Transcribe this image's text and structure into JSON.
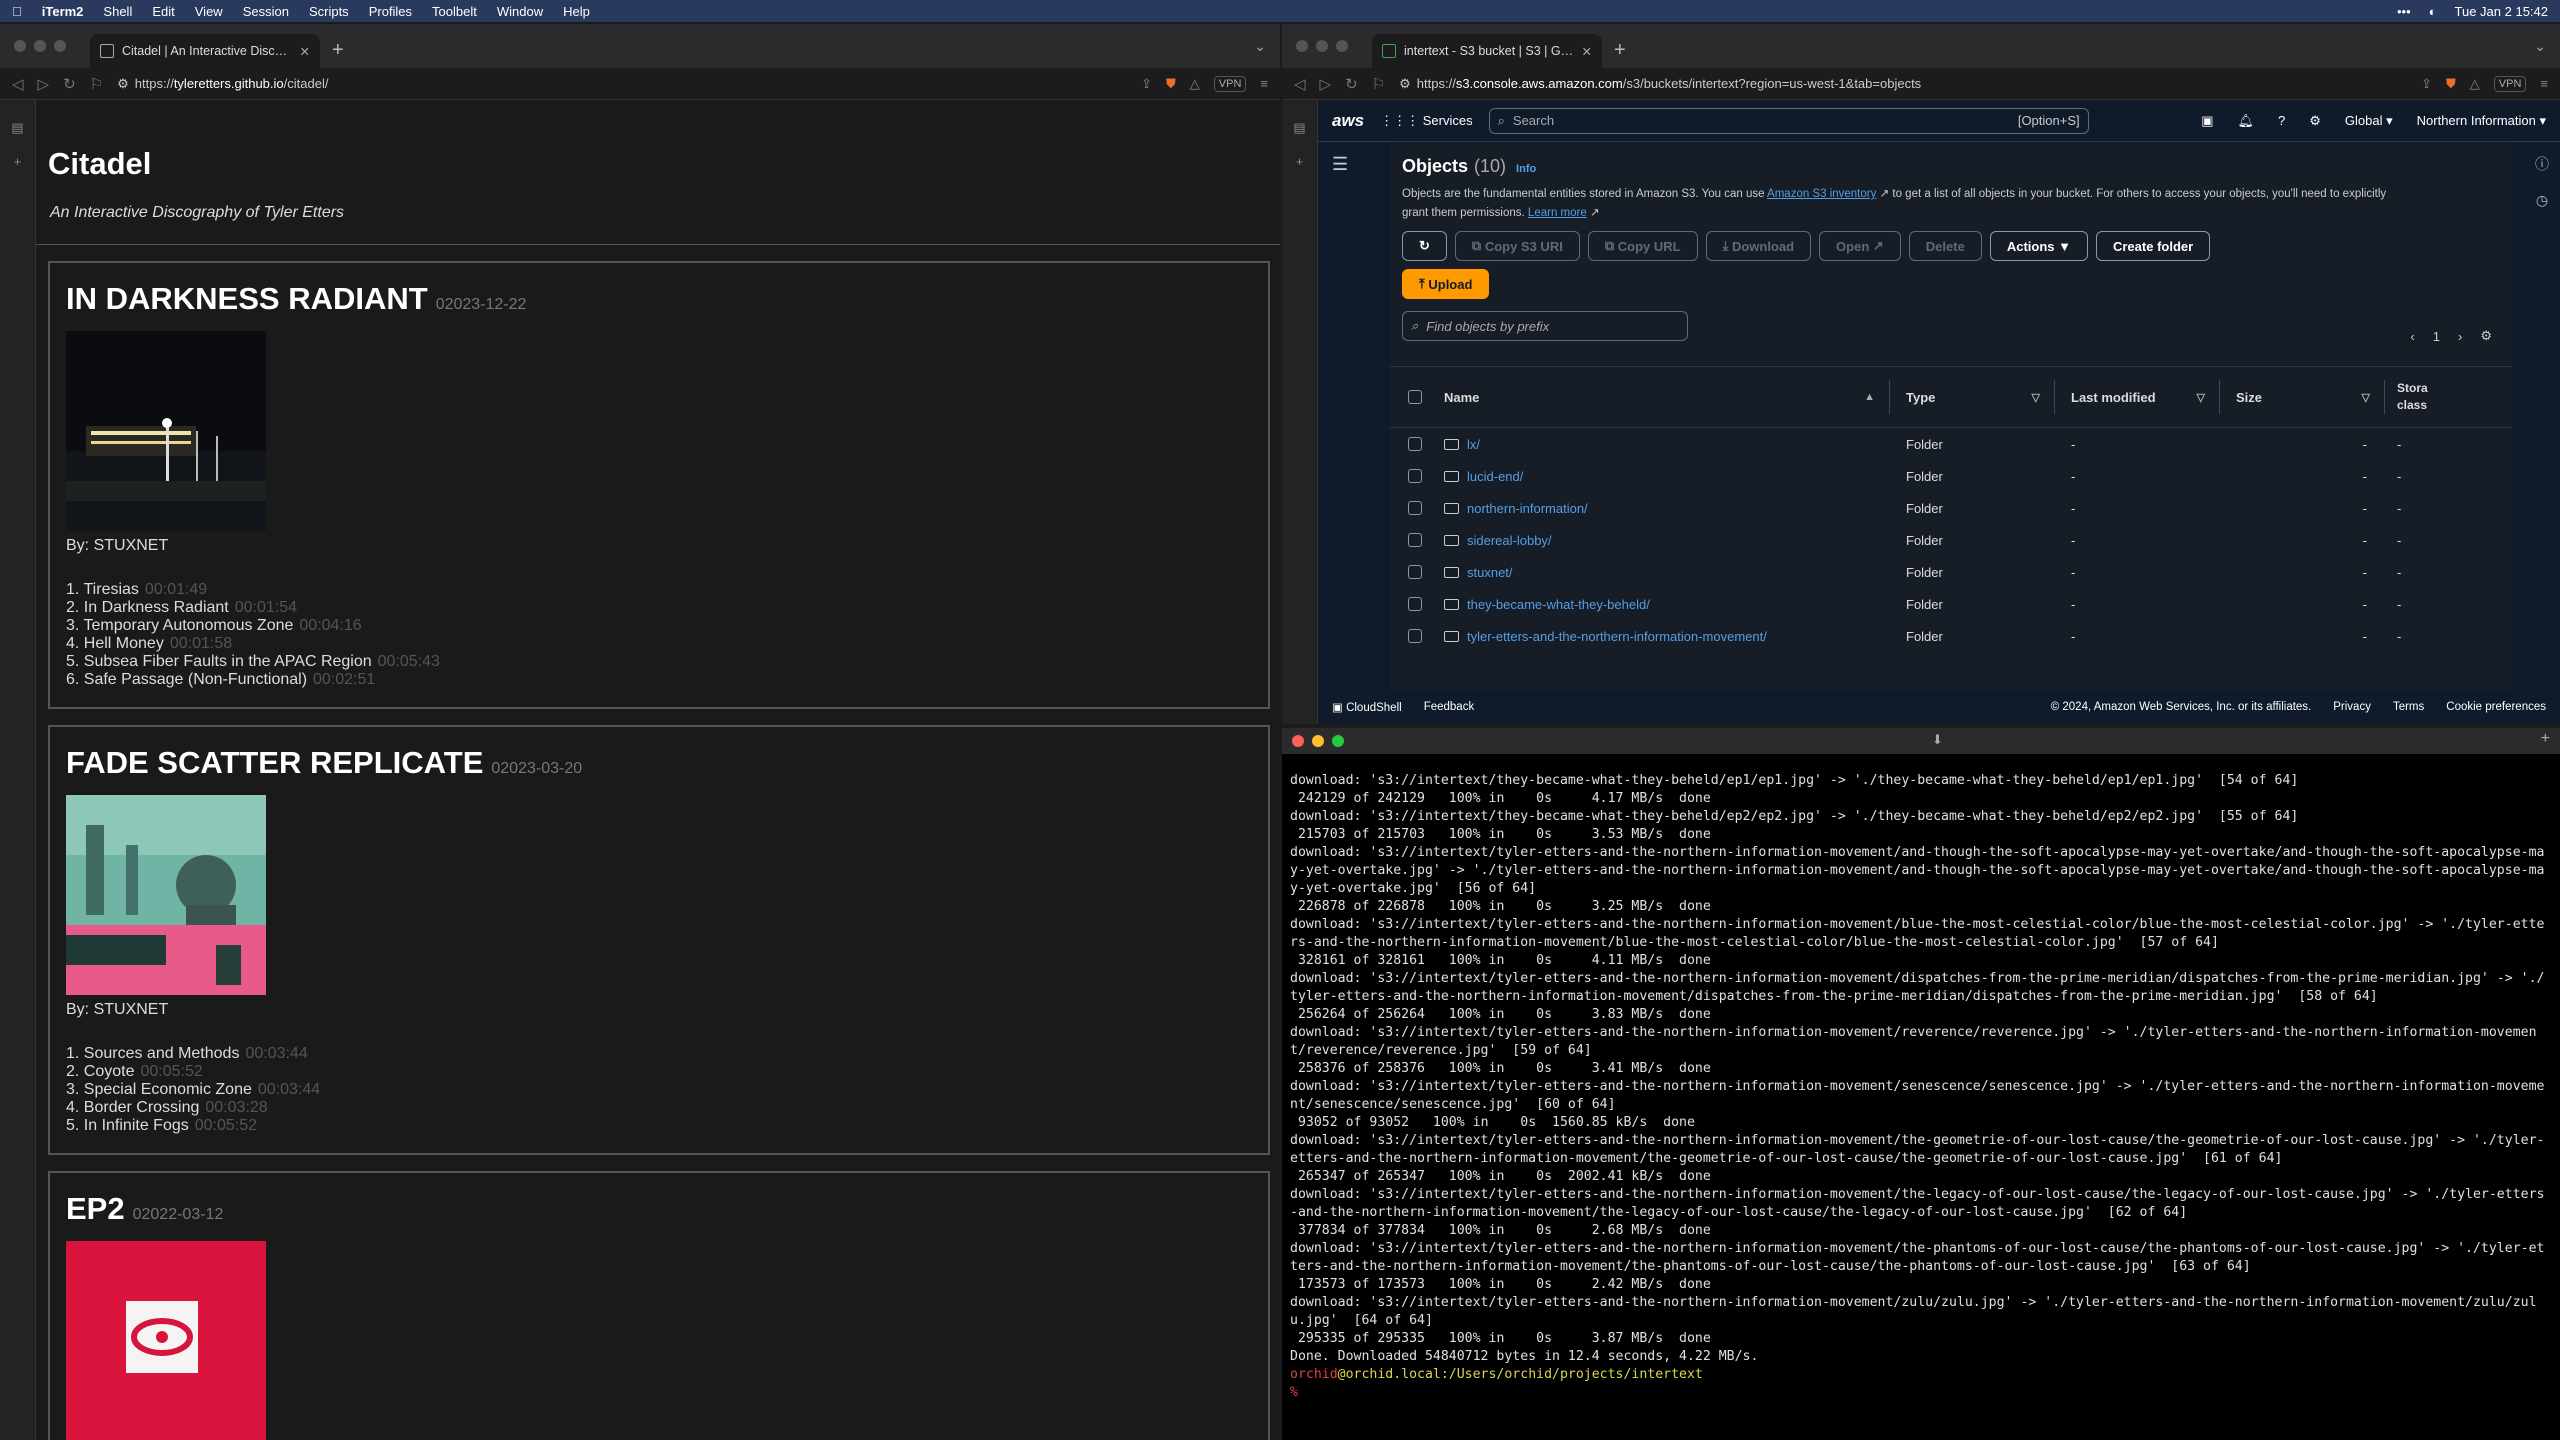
{
  "menubar": {
    "app": "iTerm2",
    "items": [
      "Shell",
      "Edit",
      "View",
      "Session",
      "Scripts",
      "Profiles",
      "Toolbelt",
      "Window",
      "Help"
    ],
    "clock": "Tue Jan 2  15:42"
  },
  "left_browser": {
    "tab_title": "Citadel | An Interactive Discogr...",
    "url_prefix": "https://",
    "url_host": "tyleretters.github.io",
    "url_path": "/citadel/",
    "vpn": "VPN",
    "page": {
      "title": "Citadel",
      "subtitle": "An Interactive Discography of Tyler Etters",
      "albums": [
        {
          "name": "IN DARKNESS RADIANT",
          "date": "02023-12-22",
          "by": "By: STUXNET",
          "tracks": [
            {
              "t": "1. Tiresias",
              "d": "00:01:49"
            },
            {
              "t": "2. In Darkness Radiant",
              "d": "00:01:54"
            },
            {
              "t": "3. Temporary Autonomous Zone",
              "d": "00:04:16"
            },
            {
              "t": "4. Hell Money",
              "d": "00:01:58"
            },
            {
              "t": "5. Subsea Fiber Faults in the APAC Region",
              "d": "00:05:43"
            },
            {
              "t": "6. Safe Passage (Non-Functional)",
              "d": "00:02:51"
            }
          ]
        },
        {
          "name": "FADE SCATTER REPLICATE",
          "date": "02023-03-20",
          "by": "By: STUXNET",
          "tracks": [
            {
              "t": "1. Sources and Methods",
              "d": "00:03:44"
            },
            {
              "t": "2. Coyote",
              "d": "00:05:52"
            },
            {
              "t": "3. Special Economic Zone",
              "d": "00:03:44"
            },
            {
              "t": "4. Border Crossing",
              "d": "00:03:28"
            },
            {
              "t": "5. In Infinite Fogs",
              "d": "00:05:52"
            }
          ]
        },
        {
          "name": "EP2",
          "date": "02022-03-12",
          "by": "",
          "tracks": []
        }
      ]
    }
  },
  "right_browser": {
    "tab_title": "intertext - S3 bucket | S3 | Glo...",
    "url_prefix": "https://",
    "url_host": "s3.console.aws.amazon.com",
    "url_path": "/s3/buckets/intertext?region=us-west-1&tab=objects",
    "vpn": "VPN",
    "aws": {
      "logo": "aws",
      "services": "Services",
      "search_placeholder": "Search",
      "search_kbd": "[Option+S]",
      "region": "Global ▾",
      "account": "Northern Information ▾",
      "objects_title": "Objects",
      "objects_count": "(10)",
      "info": "Info",
      "desc_1": "Objects are the fundamental entities stored in Amazon S3. You can use ",
      "desc_link": "Amazon S3 inventory",
      "desc_2": " to get a list of all objects in your bucket. For others to access your objects, you'll need to explicitly grant them permissions. ",
      "desc_learn": "Learn more",
      "buttons": {
        "copy_uri": "Copy S3 URI",
        "copy_url": "Copy URL",
        "download": "Download",
        "open": "Open",
        "delete": "Delete",
        "actions": "Actions ▼",
        "create_folder": "Create folder",
        "upload": "Upload"
      },
      "find_placeholder": "Find objects by prefix",
      "page_num": "1",
      "columns": {
        "name": "Name",
        "type": "Type",
        "modified": "Last modified",
        "size": "Size",
        "storage": "Stora class"
      },
      "rows": [
        {
          "name": "lx/",
          "type": "Folder",
          "modified": "-",
          "size": "-",
          "storage": "-"
        },
        {
          "name": "lucid-end/",
          "type": "Folder",
          "modified": "-",
          "size": "-",
          "storage": "-"
        },
        {
          "name": "northern-information/",
          "type": "Folder",
          "modified": "-",
          "size": "-",
          "storage": "-"
        },
        {
          "name": "sidereal-lobby/",
          "type": "Folder",
          "modified": "-",
          "size": "-",
          "storage": "-"
        },
        {
          "name": "stuxnet/",
          "type": "Folder",
          "modified": "-",
          "size": "-",
          "storage": "-"
        },
        {
          "name": "they-became-what-they-beheld/",
          "type": "Folder",
          "modified": "-",
          "size": "-",
          "storage": "-"
        },
        {
          "name": "tyler-etters-and-the-northern-information-movement/",
          "type": "Folder",
          "modified": "-",
          "size": "-",
          "storage": "-"
        }
      ],
      "footer": {
        "cloudshell": "CloudShell",
        "feedback": "Feedback",
        "copyright": "© 2024, Amazon Web Services, Inc. or its affiliates.",
        "privacy": "Privacy",
        "terms": "Terms",
        "cookie": "Cookie preferences"
      }
    }
  },
  "terminal": {
    "output": "download: 's3://intertext/they-became-what-they-beheld/ep1/ep1.jpg' -> './they-became-what-they-beheld/ep1/ep1.jpg'  [54 of 64]\n 242129 of 242129   100% in    0s     4.17 MB/s  done\ndownload: 's3://intertext/they-became-what-they-beheld/ep2/ep2.jpg' -> './they-became-what-they-beheld/ep2/ep2.jpg'  [55 of 64]\n 215703 of 215703   100% in    0s     3.53 MB/s  done\ndownload: 's3://intertext/tyler-etters-and-the-northern-information-movement/and-though-the-soft-apocalypse-may-yet-overtake/and-though-the-soft-apocalypse-may-yet-overtake.jpg' -> './tyler-etters-and-the-northern-information-movement/and-though-the-soft-apocalypse-may-yet-overtake/and-though-the-soft-apocalypse-may-yet-overtake.jpg'  [56 of 64]\n 226878 of 226878   100% in    0s     3.25 MB/s  done\ndownload: 's3://intertext/tyler-etters-and-the-northern-information-movement/blue-the-most-celestial-color/blue-the-most-celestial-color.jpg' -> './tyler-etters-and-the-northern-information-movement/blue-the-most-celestial-color/blue-the-most-celestial-color.jpg'  [57 of 64]\n 328161 of 328161   100% in    0s     4.11 MB/s  done\ndownload: 's3://intertext/tyler-etters-and-the-northern-information-movement/dispatches-from-the-prime-meridian/dispatches-from-the-prime-meridian.jpg' -> './tyler-etters-and-the-northern-information-movement/dispatches-from-the-prime-meridian/dispatches-from-the-prime-meridian.jpg'  [58 of 64]\n 256264 of 256264   100% in    0s     3.83 MB/s  done\ndownload: 's3://intertext/tyler-etters-and-the-northern-information-movement/reverence/reverence.jpg' -> './tyler-etters-and-the-northern-information-movement/reverence/reverence.jpg'  [59 of 64]\n 258376 of 258376   100% in    0s     3.41 MB/s  done\ndownload: 's3://intertext/tyler-etters-and-the-northern-information-movement/senescence/senescence.jpg' -> './tyler-etters-and-the-northern-information-movement/senescence/senescence.jpg'  [60 of 64]\n 93052 of 93052   100% in    0s  1560.85 kB/s  done\ndownload: 's3://intertext/tyler-etters-and-the-northern-information-movement/the-geometrie-of-our-lost-cause/the-geometrie-of-our-lost-cause.jpg' -> './tyler-etters-and-the-northern-information-movement/the-geometrie-of-our-lost-cause/the-geometrie-of-our-lost-cause.jpg'  [61 of 64]\n 265347 of 265347   100% in    0s  2002.41 kB/s  done\ndownload: 's3://intertext/tyler-etters-and-the-northern-information-movement/the-legacy-of-our-lost-cause/the-legacy-of-our-lost-cause.jpg' -> './tyler-etters-and-the-northern-information-movement/the-legacy-of-our-lost-cause/the-legacy-of-our-lost-cause.jpg'  [62 of 64]\n 377834 of 377834   100% in    0s     2.68 MB/s  done\ndownload: 's3://intertext/tyler-etters-and-the-northern-information-movement/the-phantoms-of-our-lost-cause/the-phantoms-of-our-lost-cause.jpg' -> './tyler-etters-and-the-northern-information-movement/the-phantoms-of-our-lost-cause/the-phantoms-of-our-lost-cause.jpg'  [63 of 64]\n 173573 of 173573   100% in    0s     2.42 MB/s  done\ndownload: 's3://intertext/tyler-etters-and-the-northern-information-movement/zulu/zulu.jpg' -> './tyler-etters-and-the-northern-information-movement/zulu/zulu.jpg'  [64 of 64]\n 295335 of 295335   100% in    0s     3.87 MB/s  done\nDone. Downloaded 54840712 bytes in 12.4 seconds, 4.22 MB/s.\n",
    "prompt_user": "orchid",
    "prompt_host": "@orchid.local:/Users/orchid/projects/intertext",
    "prompt_char": "%"
  }
}
